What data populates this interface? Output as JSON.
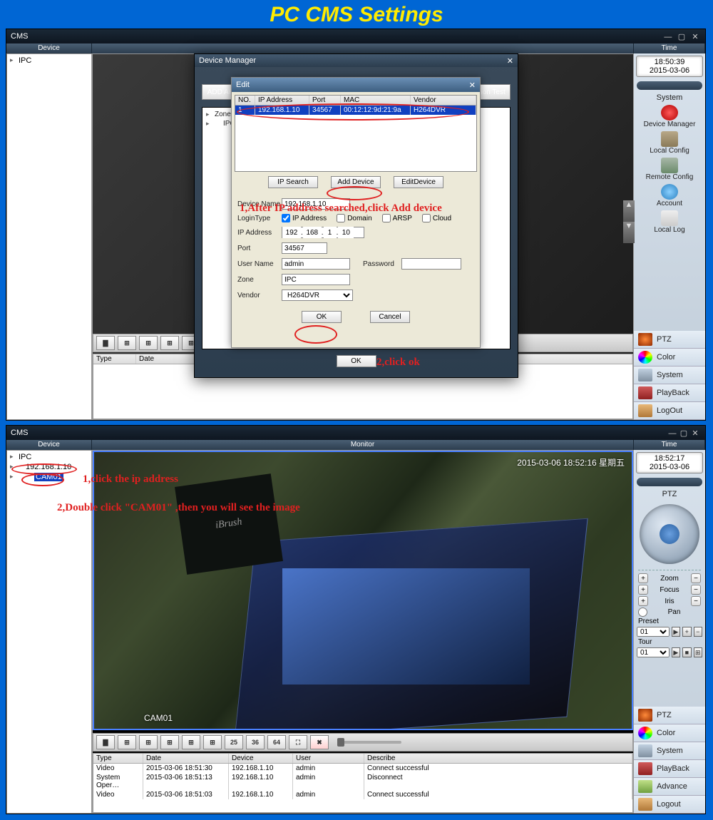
{
  "banner": "PC CMS Settings",
  "annot": {
    "top1": "1,After IP address searched,click Add device",
    "top2": "2,click ok",
    "bot1": "1,click the ip address",
    "bot2": "2,Double click \"CAM01\" ,then you will see the image"
  },
  "app": {
    "title": "CMS",
    "headers": {
      "device": "Device",
      "time": "Time",
      "monitor": "Monitor"
    }
  },
  "time1": {
    "clock": "18:50:39",
    "date": "2015-03-06"
  },
  "time2": {
    "clock": "18:52:17",
    "date": "2015-03-06"
  },
  "tree_top": {
    "root": "IPC"
  },
  "tree_bot": {
    "root": "IPC",
    "ip": "192.168.1.10",
    "cam": "CAM01"
  },
  "system_panel": {
    "title": "System",
    "items": [
      "Device Manager",
      "Local Config",
      "Remote Config",
      "Account",
      "Local Log"
    ]
  },
  "side_list": [
    "PTZ",
    "Color",
    "System",
    "PlayBack",
    "LogOut"
  ],
  "side_list2": [
    "PTZ",
    "Color",
    "System",
    "PlayBack",
    "Advance",
    "Logout"
  ],
  "ptz": {
    "title": "PTZ",
    "zoom": "Zoom",
    "focus": "Focus",
    "iris": "Iris",
    "pan": "Pan",
    "preset": "Preset",
    "tour": "Tour",
    "sel": "01"
  },
  "dm": {
    "title": "Device Manager",
    "add_area_btn": "ADD AREA",
    "conn_test_btn": "Connection Test",
    "zone": "Zone",
    "ipc": "IPC",
    "ok": "OK"
  },
  "edit": {
    "title": "Edit",
    "cols": {
      "no": "NO.",
      "ip": "IP Address",
      "port": "Port",
      "mac": "MAC",
      "vendor": "Vendor"
    },
    "row": {
      "no": "1",
      "ip": "192.168.1.10",
      "port": "34567",
      "mac": "00:12:12:9d:21:9a",
      "vendor": "H264DVR"
    },
    "btns": {
      "search": "IP Search",
      "add": "Add Device",
      "editd": "EditDevice",
      "ok": "OK",
      "cancel": "Cancel"
    },
    "fields": {
      "devname_l": "Device Name",
      "devname": "192.168.1.10",
      "logintype_l": "LoginType",
      "ipaddr_chk": "IP Address",
      "domain_chk": "Domain",
      "arsp_chk": "ARSP",
      "cloud_chk": "Cloud",
      "ipaddr_l": "IP Address",
      "ip1": "192",
      "ip2": "168",
      "ip3": "1",
      "ip4": "10",
      "port_l": "Port",
      "port": "34567",
      "user_l": "User Name",
      "user": "admin",
      "pass_l": "Password",
      "pass": "",
      "zone_l": "Zone",
      "zone": "IPC",
      "vendor_l": "Vendor",
      "vendor": "H264DVR"
    }
  },
  "grid_nums": [
    "25",
    "36",
    "64"
  ],
  "log1": {
    "cols": {
      "type": "Type",
      "date": "Date"
    }
  },
  "log2": {
    "cols": {
      "type": "Type",
      "date": "Date",
      "device": "Device",
      "user": "User",
      "describe": "Describe"
    },
    "rows": [
      {
        "type": "Video",
        "date": "2015-03-06 18:51:30",
        "device": "192.168.1.10",
        "user": "admin",
        "describe": "Connect successful"
      },
      {
        "type": "System Oper…",
        "date": "2015-03-06 18:51:13",
        "device": "192.168.1.10",
        "user": "admin",
        "describe": "Disconnect"
      },
      {
        "type": "Video",
        "date": "2015-03-06 18:51:03",
        "device": "192.168.1.10",
        "user": "admin",
        "describe": "Connect successful"
      }
    ]
  },
  "cam": {
    "ts": "2015-03-06 18:52:16 星期五",
    "label": "CAM01"
  }
}
